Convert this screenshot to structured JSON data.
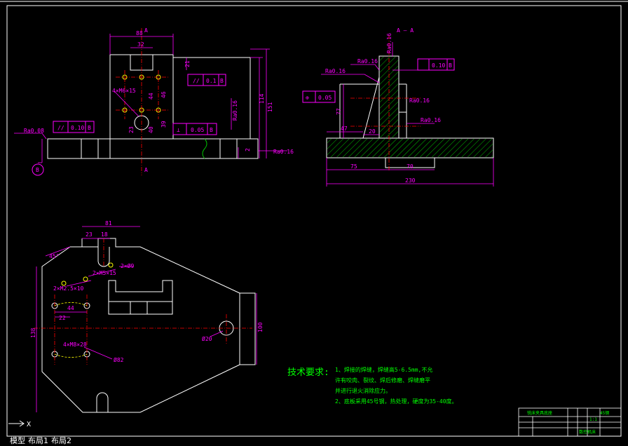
{
  "colors": {
    "background": "#000000",
    "outline": "#ffffff",
    "dimension": "#ff00ff",
    "center_line": "#ff0000",
    "text_green": "#00ff00",
    "hatch": "#00c000",
    "hole": "#ffff00"
  },
  "front_view": {
    "section_label_top": "A",
    "section_label_bottom": "A",
    "dim_width": "88",
    "dim_slot": "32",
    "dim_21": "21",
    "dim_46": "46",
    "dim_44": "44",
    "dim_39": "39",
    "dim_40": "40",
    "dim_23": "23",
    "dim_2": "2",
    "dim_114": "114",
    "dim_151": "151",
    "hole_note": "4×M6×15",
    "ra_left": "Ra0.08",
    "ra_right": "Ra0.16",
    "ra_vertical": "Ra0.16",
    "tol_parallel_top": "0.1",
    "tol_parallel_top_ref": "B",
    "tol_parallel_left": "0.10",
    "tol_parallel_left_ref": "B",
    "tol_perp": "0.05",
    "tol_perp_ref": "B",
    "datum": "B"
  },
  "side_view": {
    "section_label": "A — A",
    "ra_top": "Ra0.16",
    "ra_left": "Ra0.16",
    "ra_mid": "Ra0.16",
    "ra_right": "Ra0.16",
    "tol_top": "0.10",
    "tol_top_ref": "B",
    "tol_pos": "0.05",
    "dim_77": "77",
    "dim_47": "47",
    "dim_20": "20",
    "dim_75": "75",
    "dim_70": "70",
    "dim_230": "230"
  },
  "plan_view": {
    "dim_81": "81",
    "dim_23": "23",
    "dim_18": "18",
    "dim_45": "45°",
    "note_2b9": "2×Ø9",
    "note_m5": "2×M5×15",
    "note_m2": "2×M2.5×10",
    "dim_44": "44",
    "dim_22": "22",
    "note_m8": "4×M8×28",
    "note_r82": "Ø82",
    "note_d20": "Ø20",
    "dim_138": "138",
    "dim_100": "100"
  },
  "tech_req": {
    "title": "技术要求:",
    "line1": "1、焊接的焊缝，焊缝高5-6.5mm,不允",
    "line2": "许有咬肉、裂纹、焊后修磨、焊缝磨平",
    "line3": "并进行退火消除应力。",
    "line4": "2、底板采用45号钢，热处理，硬度为35-40度。"
  },
  "title_block": {
    "title": "铣床夹具底座",
    "row2": "1:1",
    "row3": "45钢",
    "row4": "数控机床"
  },
  "bottom_tabs": {
    "model": "模型",
    "layout1": "布局1",
    "layout2": "布局2"
  }
}
